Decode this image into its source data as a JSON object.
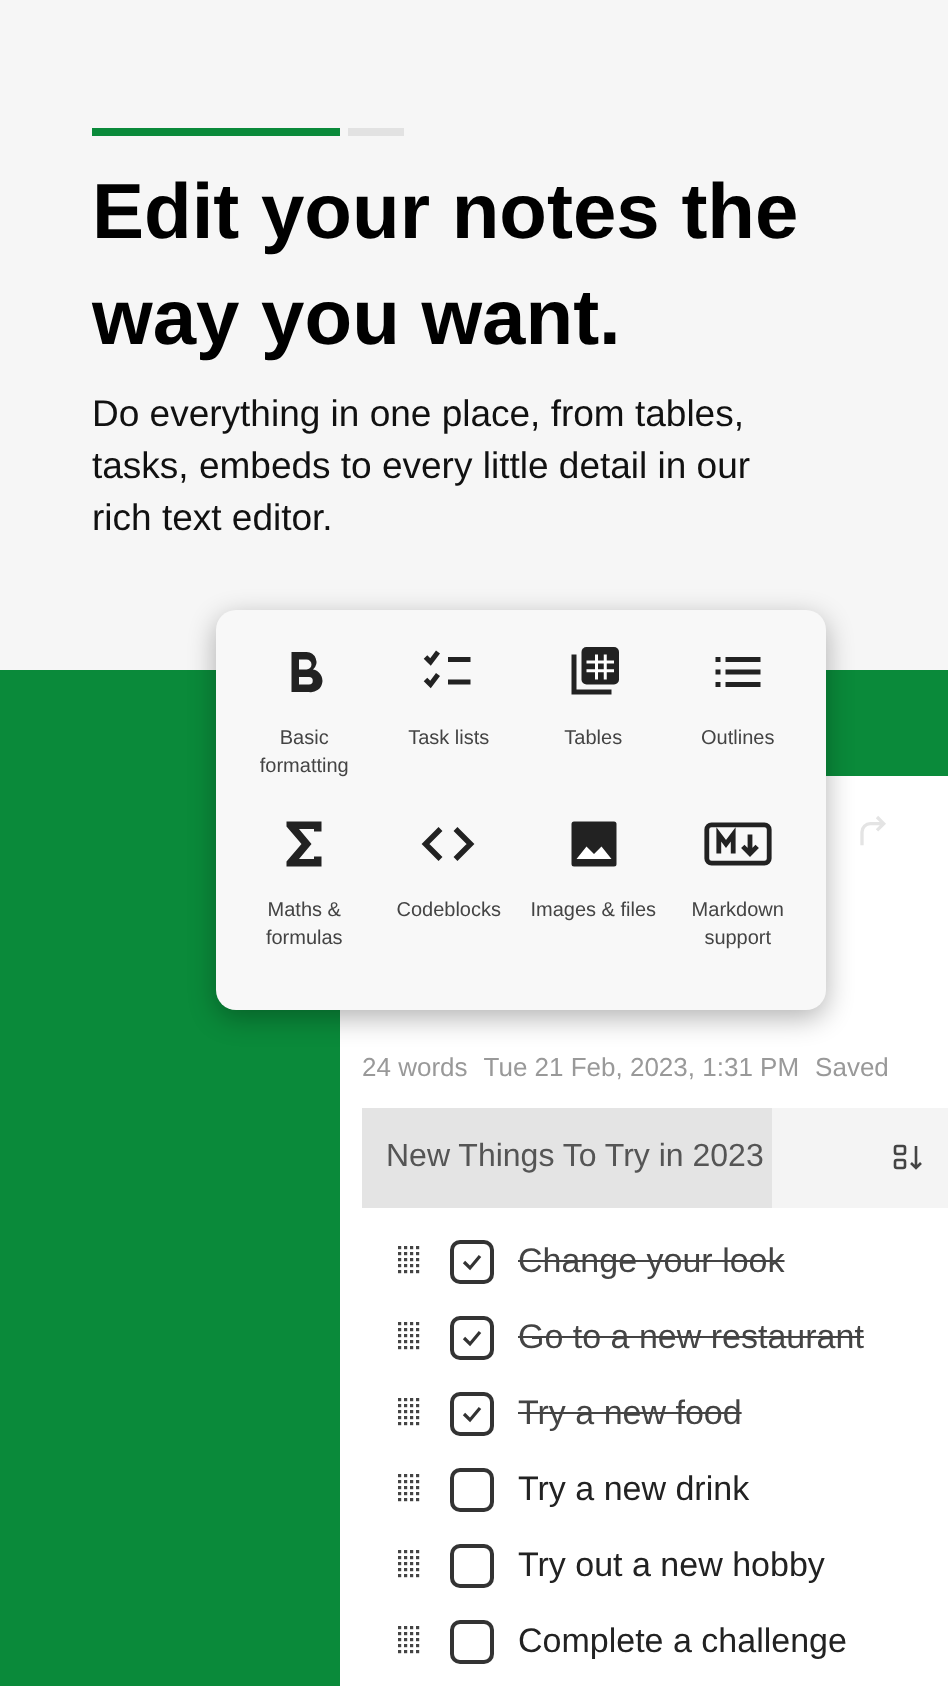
{
  "pager": [
    {
      "selected": true
    },
    {
      "selected": false
    }
  ],
  "headline": "Edit your notes the way you want.",
  "description": "Do everything in one place, from tables, tasks, embeds to every little detail in our rich text editor.",
  "features": [
    {
      "kind": "bold",
      "label": "Basic formatting"
    },
    {
      "kind": "tasks",
      "label": "Task lists"
    },
    {
      "kind": "table",
      "label": "Tables"
    },
    {
      "kind": "outline",
      "label": "Outlines"
    },
    {
      "kind": "sigma",
      "label": "Maths & formulas"
    },
    {
      "kind": "code",
      "label": "Codeblocks"
    },
    {
      "kind": "image",
      "label": "Images & files"
    },
    {
      "kind": "markdown",
      "label": "Markdown support"
    }
  ],
  "note": {
    "words": "24 words",
    "date": "Tue 21 Feb, 2023, 1:31 PM",
    "status": "Saved",
    "section": {
      "title": "New Things To Try in 2023",
      "level": 0.7
    },
    "tasks": [
      {
        "text": "Change your look",
        "checked": true
      },
      {
        "text": "Go to a new restaurant",
        "checked": true
      },
      {
        "text": "Try a new food",
        "checked": true
      },
      {
        "text": "Try a new drink",
        "checked": false
      },
      {
        "text": "Try out a new hobby",
        "checked": false
      },
      {
        "text": "Complete a challenge",
        "checked": false
      }
    ]
  }
}
